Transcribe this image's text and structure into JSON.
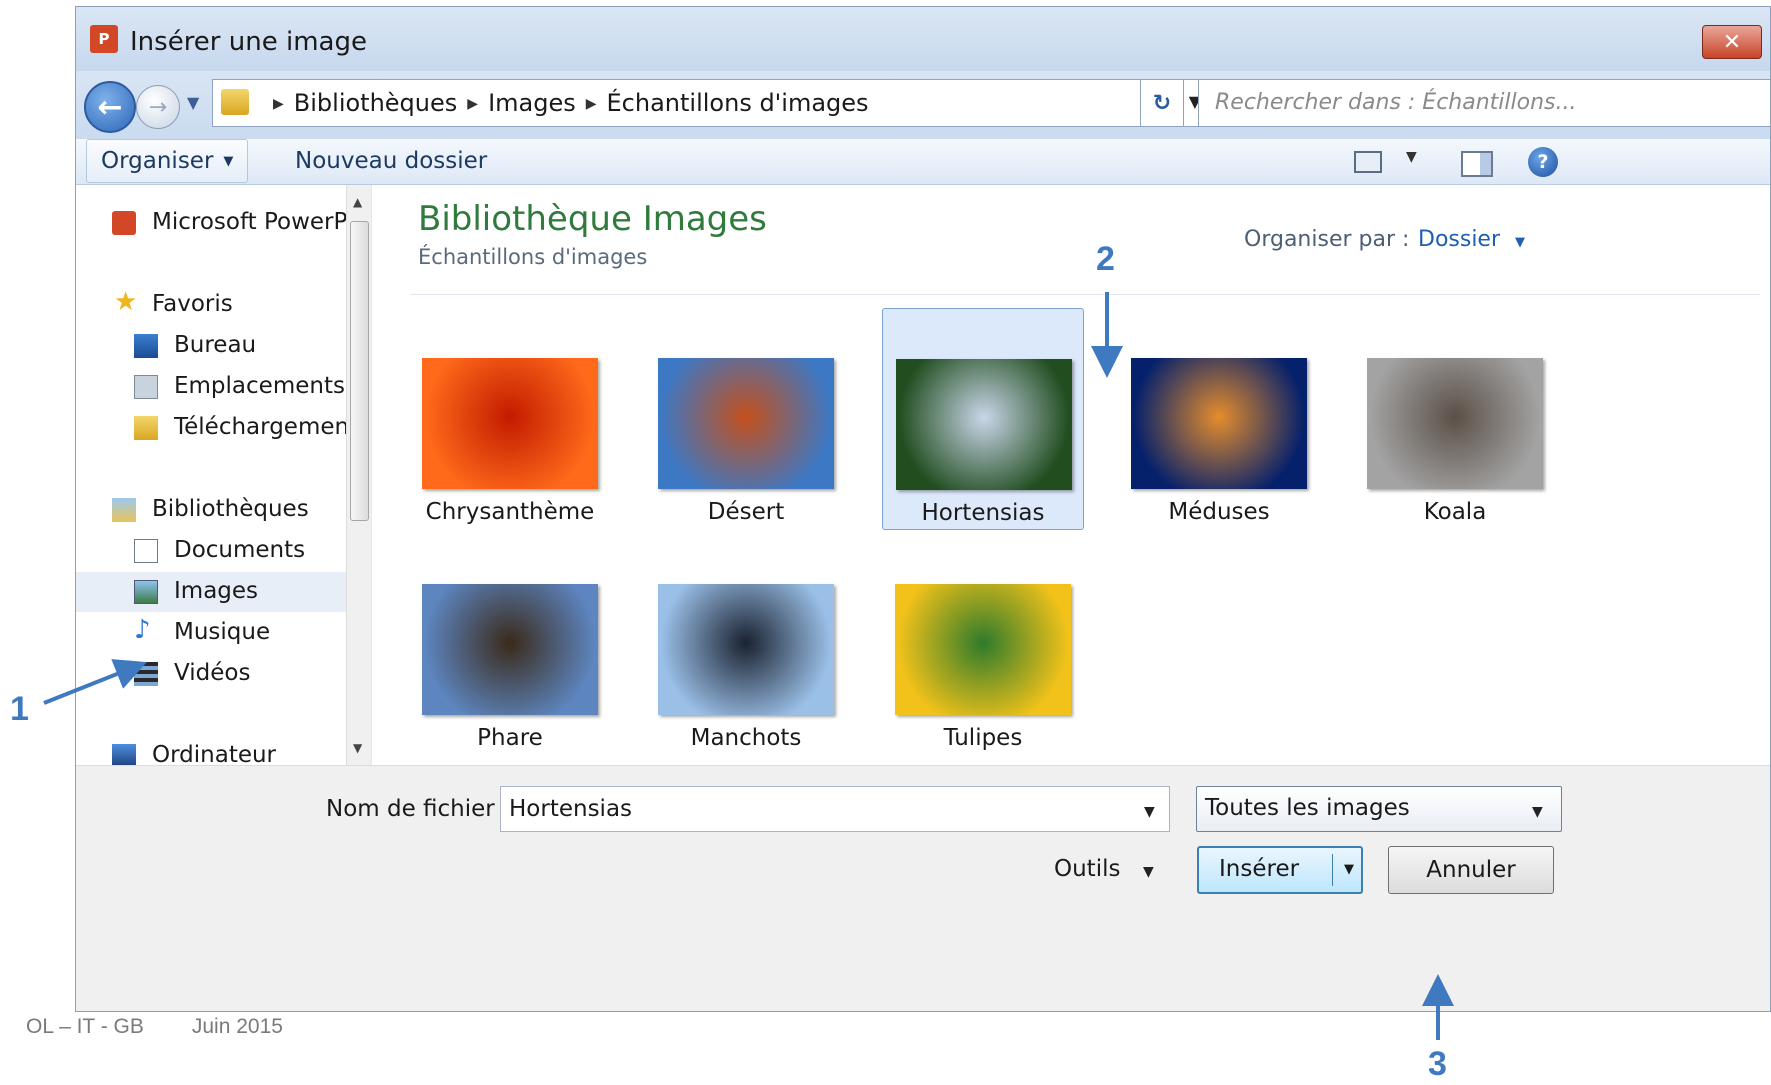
{
  "window": {
    "title": "Insérer une image",
    "app_icon_text": "P",
    "close_label": "✕"
  },
  "address": {
    "crumbs": [
      "Bibliothèques",
      "Images",
      "Échantillons d'images"
    ],
    "search_placeholder": "Rechercher dans : Échantillons..."
  },
  "toolbar": {
    "organise_label": "Organiser",
    "new_folder_label": "Nouveau dossier"
  },
  "sidebar": {
    "items": [
      {
        "label": "Microsoft PowerPoint",
        "icon": "powerpoint-icon"
      },
      {
        "label": "Favoris",
        "icon": "star-icon"
      },
      {
        "label": "Bureau",
        "icon": "desktop-icon"
      },
      {
        "label": "Emplacements récents",
        "icon": "recent-places-icon"
      },
      {
        "label": "Téléchargements",
        "icon": "downloads-icon"
      },
      {
        "label": "Bibliothèques",
        "icon": "libraries-icon"
      },
      {
        "label": "Documents",
        "icon": "documents-icon"
      },
      {
        "label": "Images",
        "icon": "pictures-icon",
        "selected": true
      },
      {
        "label": "Musique",
        "icon": "music-icon"
      },
      {
        "label": "Vidéos",
        "icon": "videos-icon"
      },
      {
        "label": "Ordinateur",
        "icon": "computer-icon"
      }
    ]
  },
  "main": {
    "library_title": "Bibliothèque Images",
    "library_subtitle": "Échantillons d'images",
    "arrange_label": "Organiser par :",
    "arrange_value": "Dossier",
    "thumbnails": [
      {
        "caption": "Chrysanthème",
        "colors": [
          "#ff6a1a",
          "#c21b00"
        ]
      },
      {
        "caption": "Désert",
        "colors": [
          "#3d78c4",
          "#c4501b"
        ]
      },
      {
        "caption": "Hortensias",
        "colors": [
          "#214d1f",
          "#c9d6e9"
        ],
        "selected": true
      },
      {
        "caption": "Méduses",
        "colors": [
          "#06216b",
          "#e58d2c"
        ]
      },
      {
        "caption": "Koala",
        "colors": [
          "#a3a3a3",
          "#5b5048"
        ]
      },
      {
        "caption": "Phare",
        "colors": [
          "#5d85bf",
          "#3a2a1a"
        ]
      },
      {
        "caption": "Manchots",
        "colors": [
          "#9bc0e8",
          "#1a2230"
        ]
      },
      {
        "caption": "Tulipes",
        "colors": [
          "#f2c21a",
          "#2e7b2b"
        ]
      }
    ]
  },
  "bottom": {
    "filename_label": "Nom de fichier :",
    "filename_value": "Hortensias",
    "filter_value": "Toutes les images",
    "tools_label": "Outils",
    "insert_label": "Insérer",
    "cancel_label": "Annuler"
  },
  "annotations": [
    "1",
    "2",
    "3"
  ],
  "footer": {
    "author": "OL – IT - GB",
    "date": "Juin 2015"
  },
  "colors": {
    "annotation_arrow": "#3f7ac0",
    "library_title": "#2f7a3c",
    "link_blue": "#1f5fb3"
  }
}
